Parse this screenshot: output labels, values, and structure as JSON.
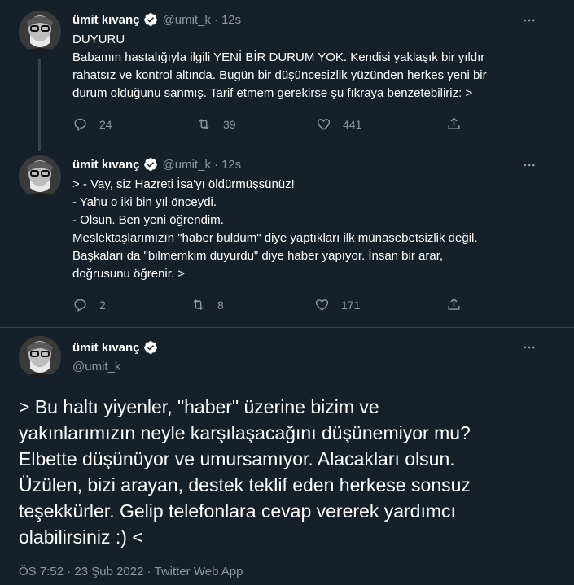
{
  "colors": {
    "background": "#15202b",
    "text": "#ffffff",
    "secondary": "#8b98a5",
    "divider": "#38444d",
    "verified": "#ffffff"
  },
  "tweets": [
    {
      "author": "ümit kıvanç",
      "handle": "@umit_k",
      "separator": "·",
      "time": "12s",
      "lines": [
        "DUYURU",
        "Babamın hastalığıyla ilgili YENİ BİR DURUM YOK. Kendisi yaklaşık bir yıldır",
        "rahatsız ve kontrol altında. Bugün bir düşüncesizlik yüzünden herkes yeni bir",
        "durum olduğunu sanmış. Tarif etmem gerekirse şu fıkraya benzetebiliriz: >"
      ],
      "replies": "24",
      "retweets": "39",
      "likes": "441"
    },
    {
      "author": "ümit kıvanç",
      "handle": "@umit_k",
      "separator": "·",
      "time": "12s",
      "lines": [
        "> - Vay, siz Hazreti İsa'yı öldürmüşsünüz!",
        "- Yahu o iki bin yıl önceydi.",
        "- Olsun. Ben yeni öğrendim.",
        "Meslektaşlarımızın \"haber buldum\" diye yaptıkları ilk münasebetsizlik değil.",
        "Başkaları da \"bilmemkim duyurdu\" diye haber yapıyor. İnsan bir arar,",
        "doğrusunu öğrenir. >"
      ],
      "replies": "2",
      "retweets": "8",
      "likes": "171"
    }
  ],
  "main_tweet": {
    "author": "ümit kıvanç",
    "handle": "@umit_k",
    "lines": [
      "> Bu haltı yiyenler, \"haber\" üzerine bizim ve",
      "yakınlarımızın neyle karşılaşacağını düşünemiyor mu?",
      "Elbette düşünüyor ve umursamıyor. Alacakları olsun.",
      "Üzülen, bizi arayan, destek teklif eden herkese sonsuz",
      "teşekkürler. Gelip telefonlara cevap vererek yardımcı",
      "olabilirsiniz :) <"
    ],
    "meta": "ÖS 7:52 · 23 Şub 2022 · Twitter Web App"
  }
}
